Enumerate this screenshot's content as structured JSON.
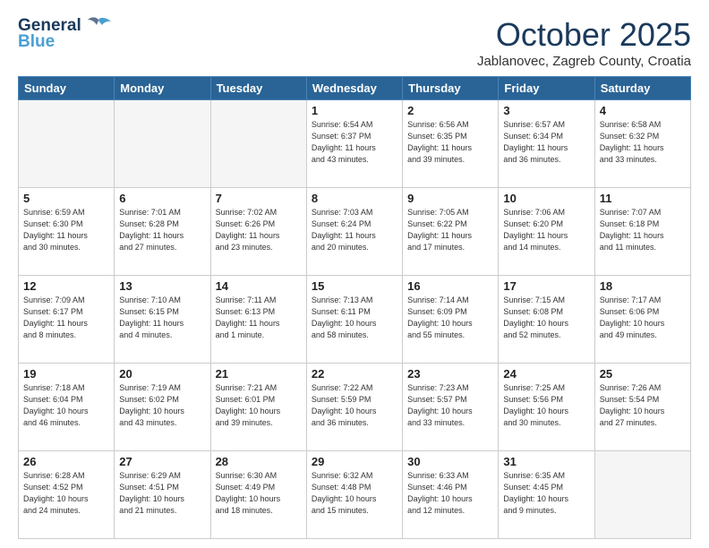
{
  "header": {
    "logo_line1": "General",
    "logo_line2": "Blue",
    "month": "October 2025",
    "location": "Jablanovec, Zagreb County, Croatia"
  },
  "days_of_week": [
    "Sunday",
    "Monday",
    "Tuesday",
    "Wednesday",
    "Thursday",
    "Friday",
    "Saturday"
  ],
  "weeks": [
    [
      {
        "day": "",
        "info": ""
      },
      {
        "day": "",
        "info": ""
      },
      {
        "day": "",
        "info": ""
      },
      {
        "day": "1",
        "info": "Sunrise: 6:54 AM\nSunset: 6:37 PM\nDaylight: 11 hours\nand 43 minutes."
      },
      {
        "day": "2",
        "info": "Sunrise: 6:56 AM\nSunset: 6:35 PM\nDaylight: 11 hours\nand 39 minutes."
      },
      {
        "day": "3",
        "info": "Sunrise: 6:57 AM\nSunset: 6:34 PM\nDaylight: 11 hours\nand 36 minutes."
      },
      {
        "day": "4",
        "info": "Sunrise: 6:58 AM\nSunset: 6:32 PM\nDaylight: 11 hours\nand 33 minutes."
      }
    ],
    [
      {
        "day": "5",
        "info": "Sunrise: 6:59 AM\nSunset: 6:30 PM\nDaylight: 11 hours\nand 30 minutes."
      },
      {
        "day": "6",
        "info": "Sunrise: 7:01 AM\nSunset: 6:28 PM\nDaylight: 11 hours\nand 27 minutes."
      },
      {
        "day": "7",
        "info": "Sunrise: 7:02 AM\nSunset: 6:26 PM\nDaylight: 11 hours\nand 23 minutes."
      },
      {
        "day": "8",
        "info": "Sunrise: 7:03 AM\nSunset: 6:24 PM\nDaylight: 11 hours\nand 20 minutes."
      },
      {
        "day": "9",
        "info": "Sunrise: 7:05 AM\nSunset: 6:22 PM\nDaylight: 11 hours\nand 17 minutes."
      },
      {
        "day": "10",
        "info": "Sunrise: 7:06 AM\nSunset: 6:20 PM\nDaylight: 11 hours\nand 14 minutes."
      },
      {
        "day": "11",
        "info": "Sunrise: 7:07 AM\nSunset: 6:18 PM\nDaylight: 11 hours\nand 11 minutes."
      }
    ],
    [
      {
        "day": "12",
        "info": "Sunrise: 7:09 AM\nSunset: 6:17 PM\nDaylight: 11 hours\nand 8 minutes."
      },
      {
        "day": "13",
        "info": "Sunrise: 7:10 AM\nSunset: 6:15 PM\nDaylight: 11 hours\nand 4 minutes."
      },
      {
        "day": "14",
        "info": "Sunrise: 7:11 AM\nSunset: 6:13 PM\nDaylight: 11 hours\nand 1 minute."
      },
      {
        "day": "15",
        "info": "Sunrise: 7:13 AM\nSunset: 6:11 PM\nDaylight: 10 hours\nand 58 minutes."
      },
      {
        "day": "16",
        "info": "Sunrise: 7:14 AM\nSunset: 6:09 PM\nDaylight: 10 hours\nand 55 minutes."
      },
      {
        "day": "17",
        "info": "Sunrise: 7:15 AM\nSunset: 6:08 PM\nDaylight: 10 hours\nand 52 minutes."
      },
      {
        "day": "18",
        "info": "Sunrise: 7:17 AM\nSunset: 6:06 PM\nDaylight: 10 hours\nand 49 minutes."
      }
    ],
    [
      {
        "day": "19",
        "info": "Sunrise: 7:18 AM\nSunset: 6:04 PM\nDaylight: 10 hours\nand 46 minutes."
      },
      {
        "day": "20",
        "info": "Sunrise: 7:19 AM\nSunset: 6:02 PM\nDaylight: 10 hours\nand 43 minutes."
      },
      {
        "day": "21",
        "info": "Sunrise: 7:21 AM\nSunset: 6:01 PM\nDaylight: 10 hours\nand 39 minutes."
      },
      {
        "day": "22",
        "info": "Sunrise: 7:22 AM\nSunset: 5:59 PM\nDaylight: 10 hours\nand 36 minutes."
      },
      {
        "day": "23",
        "info": "Sunrise: 7:23 AM\nSunset: 5:57 PM\nDaylight: 10 hours\nand 33 minutes."
      },
      {
        "day": "24",
        "info": "Sunrise: 7:25 AM\nSunset: 5:56 PM\nDaylight: 10 hours\nand 30 minutes."
      },
      {
        "day": "25",
        "info": "Sunrise: 7:26 AM\nSunset: 5:54 PM\nDaylight: 10 hours\nand 27 minutes."
      }
    ],
    [
      {
        "day": "26",
        "info": "Sunrise: 6:28 AM\nSunset: 4:52 PM\nDaylight: 10 hours\nand 24 minutes."
      },
      {
        "day": "27",
        "info": "Sunrise: 6:29 AM\nSunset: 4:51 PM\nDaylight: 10 hours\nand 21 minutes."
      },
      {
        "day": "28",
        "info": "Sunrise: 6:30 AM\nSunset: 4:49 PM\nDaylight: 10 hours\nand 18 minutes."
      },
      {
        "day": "29",
        "info": "Sunrise: 6:32 AM\nSunset: 4:48 PM\nDaylight: 10 hours\nand 15 minutes."
      },
      {
        "day": "30",
        "info": "Sunrise: 6:33 AM\nSunset: 4:46 PM\nDaylight: 10 hours\nand 12 minutes."
      },
      {
        "day": "31",
        "info": "Sunrise: 6:35 AM\nSunset: 4:45 PM\nDaylight: 10 hours\nand 9 minutes."
      },
      {
        "day": "",
        "info": ""
      }
    ]
  ]
}
